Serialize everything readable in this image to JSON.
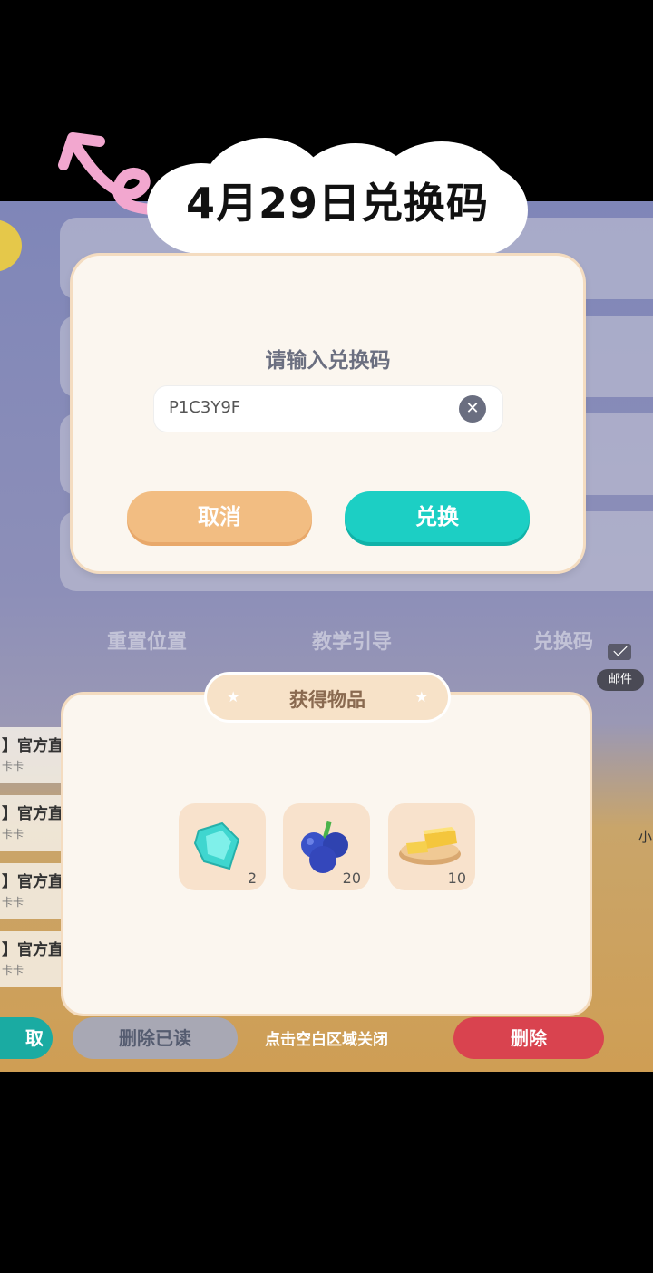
{
  "title_banner": "4月29日兑换码",
  "background": {
    "tabs": [
      "重置位置",
      "教学引导",
      "兑换码"
    ],
    "mail_label": "邮件",
    "list_items": [
      {
        "title": "】官方直",
        "sub": "卡卡"
      },
      {
        "title": "】官方直",
        "sub": "卡卡"
      },
      {
        "title": "】官方直",
        "sub": "卡卡"
      },
      {
        "title": "】官方直",
        "sub": "卡卡"
      }
    ],
    "side_text": "小",
    "buttons": {
      "left": "取",
      "delete_read": "删除已读",
      "delete": "删除"
    }
  },
  "dialog": {
    "title": "请输入兑换码",
    "input_value": "P1C3Y9F",
    "cancel_label": "取消",
    "redeem_label": "兑换"
  },
  "reward": {
    "title": "获得物品",
    "items": [
      {
        "icon": "gem-icon",
        "count": "2",
        "color": "#3fd6cf"
      },
      {
        "icon": "blueberry-icon",
        "count": "20",
        "color": "#3a52c8"
      },
      {
        "icon": "butter-icon",
        "count": "10",
        "color": "#f4c63c"
      }
    ],
    "close_hint": "点击空白区域关闭"
  },
  "colors": {
    "redeem": "#1ccfc4",
    "cancel": "#f2bd82",
    "delete": "#d9434f",
    "arrow": "#f2a7cf"
  }
}
